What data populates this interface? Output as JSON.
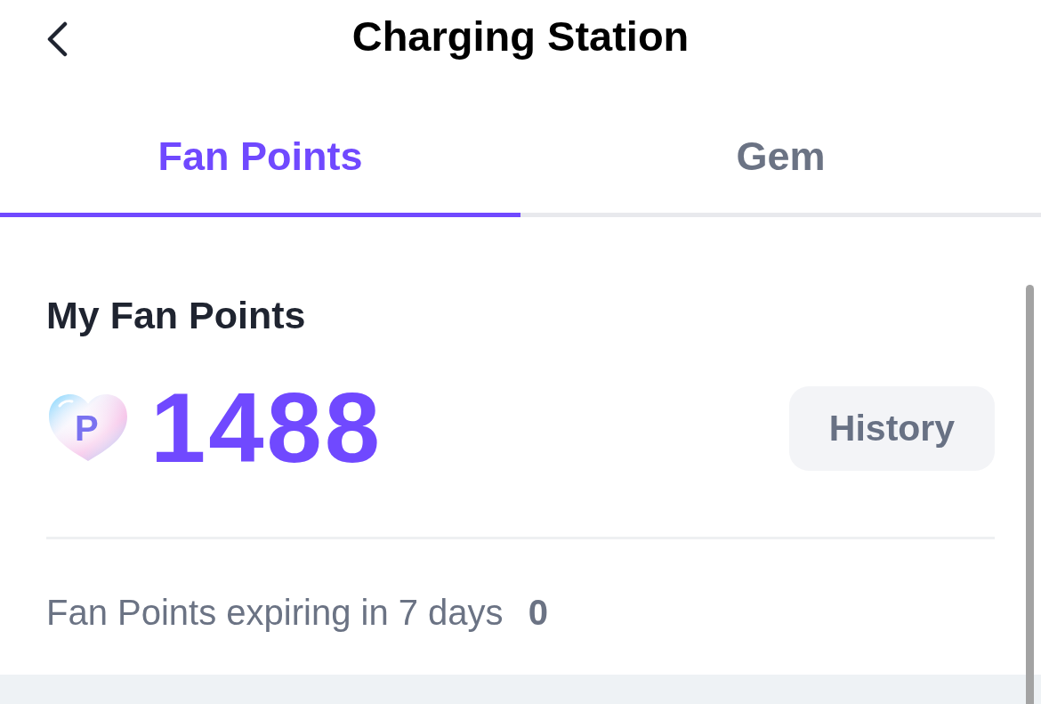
{
  "header": {
    "title": "Charging Station"
  },
  "tabs": [
    {
      "label": "Fan Points",
      "selected": true
    },
    {
      "label": "Gem",
      "selected": false
    }
  ],
  "balance": {
    "heading": "My Fan Points",
    "icon_letter": "P",
    "amount": "1488",
    "history_button": "History"
  },
  "expiring": {
    "label": "Fan Points expiring in 7 days",
    "value": "0"
  }
}
